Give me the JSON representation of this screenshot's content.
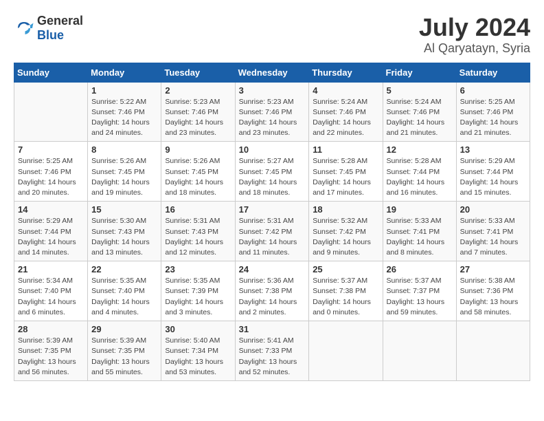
{
  "header": {
    "logo_general": "General",
    "logo_blue": "Blue",
    "title": "July 2024",
    "subtitle": "Al Qaryatayn, Syria"
  },
  "calendar": {
    "weekdays": [
      "Sunday",
      "Monday",
      "Tuesday",
      "Wednesday",
      "Thursday",
      "Friday",
      "Saturday"
    ],
    "weeks": [
      [
        {
          "day": "",
          "info": ""
        },
        {
          "day": "1",
          "info": "Sunrise: 5:22 AM\nSunset: 7:46 PM\nDaylight: 14 hours\nand 24 minutes."
        },
        {
          "day": "2",
          "info": "Sunrise: 5:23 AM\nSunset: 7:46 PM\nDaylight: 14 hours\nand 23 minutes."
        },
        {
          "day": "3",
          "info": "Sunrise: 5:23 AM\nSunset: 7:46 PM\nDaylight: 14 hours\nand 23 minutes."
        },
        {
          "day": "4",
          "info": "Sunrise: 5:24 AM\nSunset: 7:46 PM\nDaylight: 14 hours\nand 22 minutes."
        },
        {
          "day": "5",
          "info": "Sunrise: 5:24 AM\nSunset: 7:46 PM\nDaylight: 14 hours\nand 21 minutes."
        },
        {
          "day": "6",
          "info": "Sunrise: 5:25 AM\nSunset: 7:46 PM\nDaylight: 14 hours\nand 21 minutes."
        }
      ],
      [
        {
          "day": "7",
          "info": "Sunrise: 5:25 AM\nSunset: 7:46 PM\nDaylight: 14 hours\nand 20 minutes."
        },
        {
          "day": "8",
          "info": "Sunrise: 5:26 AM\nSunset: 7:45 PM\nDaylight: 14 hours\nand 19 minutes."
        },
        {
          "day": "9",
          "info": "Sunrise: 5:26 AM\nSunset: 7:45 PM\nDaylight: 14 hours\nand 18 minutes."
        },
        {
          "day": "10",
          "info": "Sunrise: 5:27 AM\nSunset: 7:45 PM\nDaylight: 14 hours\nand 18 minutes."
        },
        {
          "day": "11",
          "info": "Sunrise: 5:28 AM\nSunset: 7:45 PM\nDaylight: 14 hours\nand 17 minutes."
        },
        {
          "day": "12",
          "info": "Sunrise: 5:28 AM\nSunset: 7:44 PM\nDaylight: 14 hours\nand 16 minutes."
        },
        {
          "day": "13",
          "info": "Sunrise: 5:29 AM\nSunset: 7:44 PM\nDaylight: 14 hours\nand 15 minutes."
        }
      ],
      [
        {
          "day": "14",
          "info": "Sunrise: 5:29 AM\nSunset: 7:44 PM\nDaylight: 14 hours\nand 14 minutes."
        },
        {
          "day": "15",
          "info": "Sunrise: 5:30 AM\nSunset: 7:43 PM\nDaylight: 14 hours\nand 13 minutes."
        },
        {
          "day": "16",
          "info": "Sunrise: 5:31 AM\nSunset: 7:43 PM\nDaylight: 14 hours\nand 12 minutes."
        },
        {
          "day": "17",
          "info": "Sunrise: 5:31 AM\nSunset: 7:42 PM\nDaylight: 14 hours\nand 11 minutes."
        },
        {
          "day": "18",
          "info": "Sunrise: 5:32 AM\nSunset: 7:42 PM\nDaylight: 14 hours\nand 9 minutes."
        },
        {
          "day": "19",
          "info": "Sunrise: 5:33 AM\nSunset: 7:41 PM\nDaylight: 14 hours\nand 8 minutes."
        },
        {
          "day": "20",
          "info": "Sunrise: 5:33 AM\nSunset: 7:41 PM\nDaylight: 14 hours\nand 7 minutes."
        }
      ],
      [
        {
          "day": "21",
          "info": "Sunrise: 5:34 AM\nSunset: 7:40 PM\nDaylight: 14 hours\nand 6 minutes."
        },
        {
          "day": "22",
          "info": "Sunrise: 5:35 AM\nSunset: 7:40 PM\nDaylight: 14 hours\nand 4 minutes."
        },
        {
          "day": "23",
          "info": "Sunrise: 5:35 AM\nSunset: 7:39 PM\nDaylight: 14 hours\nand 3 minutes."
        },
        {
          "day": "24",
          "info": "Sunrise: 5:36 AM\nSunset: 7:38 PM\nDaylight: 14 hours\nand 2 minutes."
        },
        {
          "day": "25",
          "info": "Sunrise: 5:37 AM\nSunset: 7:38 PM\nDaylight: 14 hours\nand 0 minutes."
        },
        {
          "day": "26",
          "info": "Sunrise: 5:37 AM\nSunset: 7:37 PM\nDaylight: 13 hours\nand 59 minutes."
        },
        {
          "day": "27",
          "info": "Sunrise: 5:38 AM\nSunset: 7:36 PM\nDaylight: 13 hours\nand 58 minutes."
        }
      ],
      [
        {
          "day": "28",
          "info": "Sunrise: 5:39 AM\nSunset: 7:35 PM\nDaylight: 13 hours\nand 56 minutes."
        },
        {
          "day": "29",
          "info": "Sunrise: 5:39 AM\nSunset: 7:35 PM\nDaylight: 13 hours\nand 55 minutes."
        },
        {
          "day": "30",
          "info": "Sunrise: 5:40 AM\nSunset: 7:34 PM\nDaylight: 13 hours\nand 53 minutes."
        },
        {
          "day": "31",
          "info": "Sunrise: 5:41 AM\nSunset: 7:33 PM\nDaylight: 13 hours\nand 52 minutes."
        },
        {
          "day": "",
          "info": ""
        },
        {
          "day": "",
          "info": ""
        },
        {
          "day": "",
          "info": ""
        }
      ]
    ]
  }
}
